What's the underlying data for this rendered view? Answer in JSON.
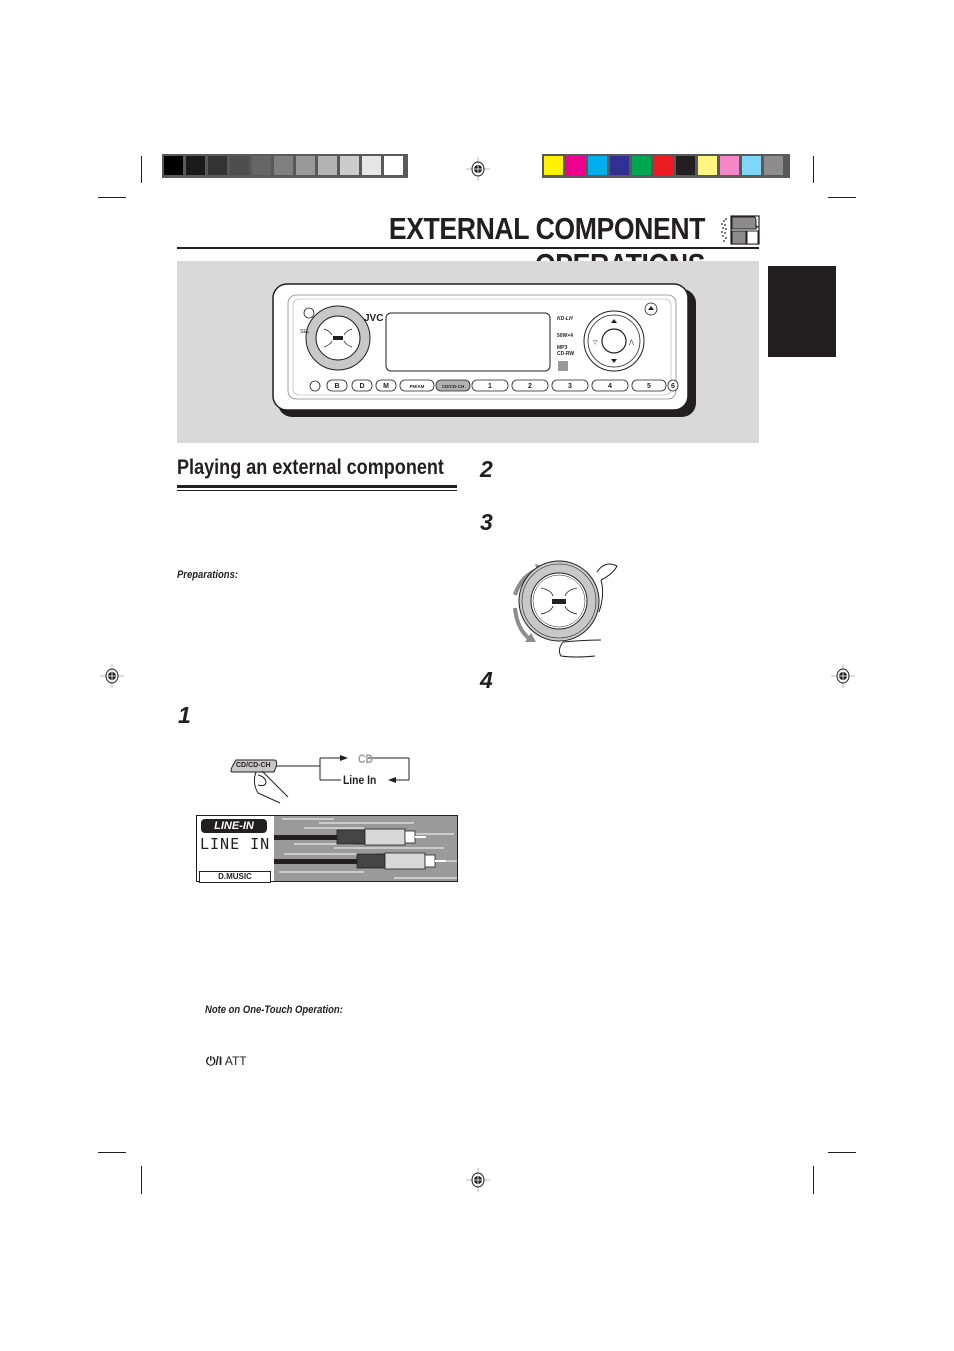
{
  "print_marks": {
    "grayscale_swatches": [
      "#000000",
      "#1a1a1a",
      "#333333",
      "#4d4d4d",
      "#666666",
      "#808080",
      "#999999",
      "#b3b3b3",
      "#cccccc",
      "#e6e6e6",
      "#ffffff"
    ],
    "color_swatches": [
      "#fff200",
      "#ec008c",
      "#00aeef",
      "#2e3192",
      "#00a651",
      "#ed1c24",
      "#231f20",
      "#fff57f",
      "#f586c8",
      "#7fd6f7",
      "#8c8c8c"
    ]
  },
  "header": {
    "title": "EXTERNAL COMPONENT OPERATIONS"
  },
  "device_panel": {
    "brand": "JVC",
    "buttons": [
      "B",
      "D",
      "M",
      "FM/AM",
      "CD/CD-CH",
      "1",
      "2",
      "3",
      "4",
      "5",
      "6"
    ]
  },
  "section": {
    "title": "Playing an external component",
    "preparations_label": "Preparations:",
    "steps": [
      "1",
      "2",
      "3",
      "4"
    ],
    "source_diagram": {
      "button_label": "CD/CD-CH",
      "option_cd": "CD",
      "option_line_in": "Line In"
    },
    "display": {
      "badge": "LINE-IN",
      "text": "LINE IN",
      "footer": "D.MUSIC"
    },
    "note_label": "Note on One-Touch Operation:",
    "att_label": "ATT"
  }
}
